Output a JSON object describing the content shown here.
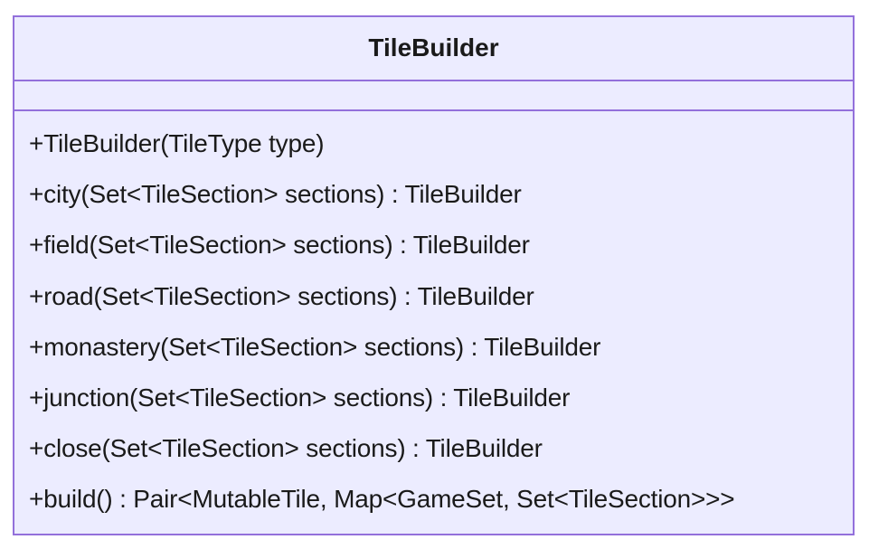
{
  "class": {
    "name": "TileBuilder",
    "attributes": [],
    "methods": [
      "+TileBuilder(TileType type)",
      "+city(Set<TileSection> sections) : TileBuilder",
      "+field(Set<TileSection> sections) : TileBuilder",
      "+road(Set<TileSection> sections) : TileBuilder",
      "+monastery(Set<TileSection> sections) : TileBuilder",
      "+junction(Set<TileSection> sections) : TileBuilder",
      "+close(Set<TileSection> sections) : TileBuilder",
      "+build() : Pair<MutableTile, Map<GameSet, Set<TileSection>>>"
    ]
  },
  "colors": {
    "fill": "#ECECFF",
    "border": "#9370DB",
    "text": "#1a1a1a"
  }
}
